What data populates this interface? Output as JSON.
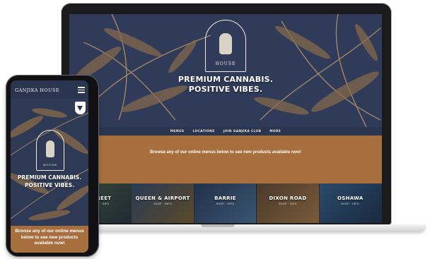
{
  "laptop_site": {
    "logo_text": "HOUSE",
    "tagline_line1": "PREMIUM CANNABIS.",
    "tagline_line2": "POSITIVE VIBES.",
    "nav": [
      "MENUS",
      "LOCATIONS",
      "JOIN GANJIKA CLUB",
      "MORE"
    ],
    "browse_message": "Browse any of our online menus below to see new products available now!",
    "stores": [
      {
        "name": "STREET",
        "sub": "SHOP · INFO"
      },
      {
        "name": "QUEEN & AIRPORT",
        "sub": "SHOP · INFO"
      },
      {
        "name": "BARRIE",
        "sub": "SHOP · INFO"
      },
      {
        "name": "DIXON ROAD",
        "sub": "SHOP · INFO"
      },
      {
        "name": "OSHAWA",
        "sub": "SHOP · INFO"
      }
    ]
  },
  "phone_site": {
    "brand": "GANJIKA HOUSE",
    "logo_text": "HOUSE",
    "tagline_line1": "PREMIUM CANNABIS.",
    "tagline_line2": "POSITIVE VIBES.",
    "browse_message": "Browse any of our online menus below to see new products available now!"
  },
  "colors": {
    "navy": "#2f3b58",
    "leaf": "#b8926a",
    "copper": "#a86f3e"
  }
}
